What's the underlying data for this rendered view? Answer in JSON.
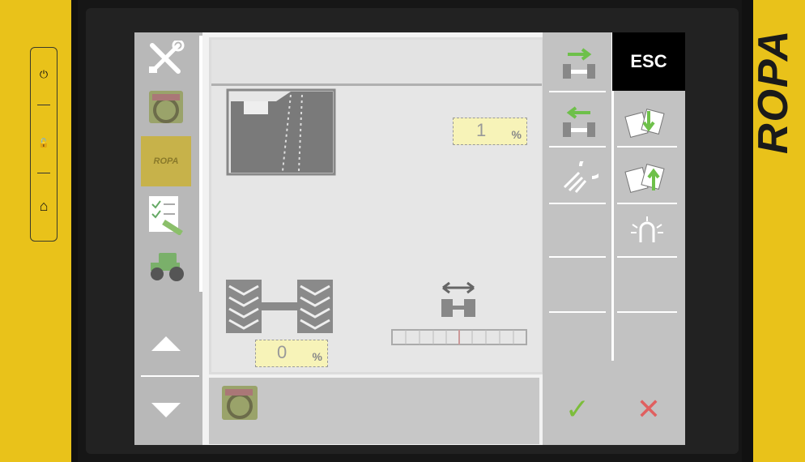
{
  "device": {
    "brand": "ROPA",
    "keys": [
      {
        "name": "power-key",
        "glyph": "⏻"
      },
      {
        "name": "unlock-key",
        "glyph": "🔓"
      },
      {
        "name": "home-key",
        "glyph": "⌂"
      }
    ]
  },
  "sidebar": {
    "items": [
      {
        "name": "tools-icon"
      },
      {
        "name": "steering-wheel-icon"
      },
      {
        "name": "ropa-logo-icon",
        "label": "ROPA"
      },
      {
        "name": "checklist-icon"
      },
      {
        "name": "tractor-icon"
      }
    ],
    "scroll_up": "▲",
    "scroll_down": "▼"
  },
  "main": {
    "top_field_value": "1",
    "top_field_unit": "%",
    "bottom_field_value": "0",
    "bottom_field_unit": "%"
  },
  "right": {
    "esc_label": "ESC",
    "buttons": [
      "axle-shift-right-icon",
      "axle-shift-left-icon",
      "headlight-icon",
      "card-down-icon",
      "card-up-icon",
      "beacon-light-icon"
    ],
    "ok_glyph": "✓",
    "cancel_glyph": "✕"
  },
  "colors": {
    "bezel": "#e9c21a",
    "field_bg": "#f7f3b8",
    "ok": "#7cbd3b",
    "cancel": "#e06060",
    "arrow_green": "#6ec04a"
  }
}
